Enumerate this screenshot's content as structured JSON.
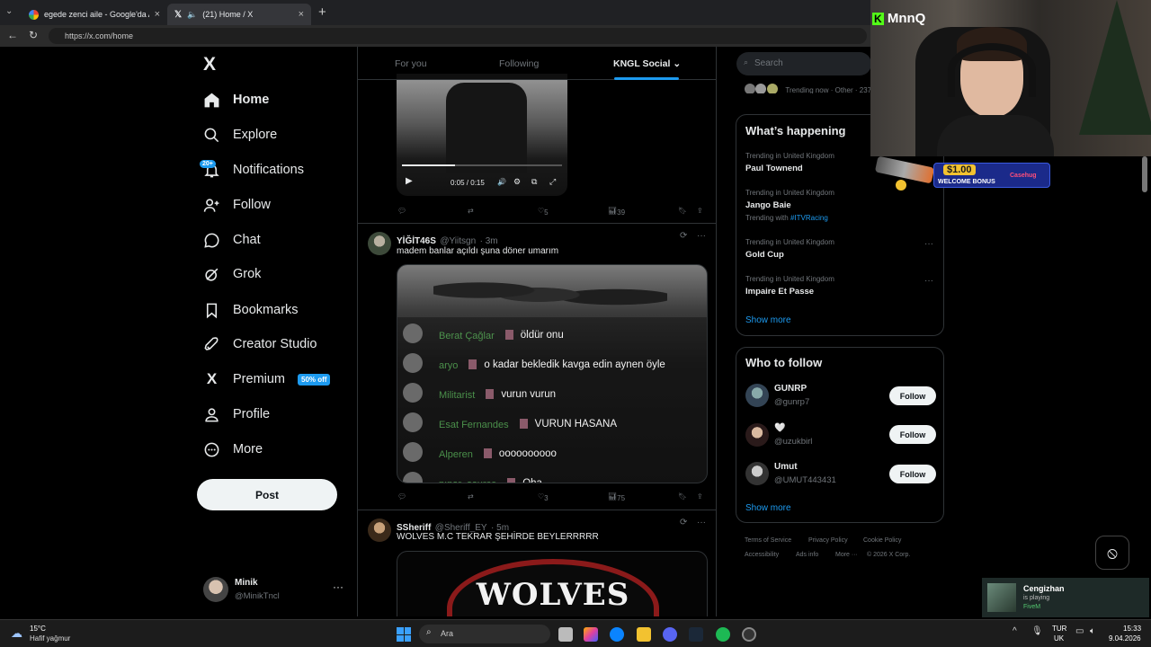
{
  "browser": {
    "tabs": [
      {
        "title": "egede zenci aile - Google'da Ara",
        "active": false
      },
      {
        "title": "(21) Home / X",
        "active": true
      }
    ],
    "url": "https://x.com/home",
    "new_tab_symbol": "+"
  },
  "sidebar": {
    "logo": "X",
    "items": [
      {
        "label": "Home",
        "icon": "home-icon",
        "active": true
      },
      {
        "label": "Explore",
        "icon": "search-icon"
      },
      {
        "label": "Notifications",
        "icon": "bell-icon",
        "badge": "20+"
      },
      {
        "label": "Follow",
        "icon": "person-add-icon"
      },
      {
        "label": "Chat",
        "icon": "chat-icon"
      },
      {
        "label": "Grok",
        "icon": "grok-icon"
      },
      {
        "label": "Bookmarks",
        "icon": "bookmark-icon"
      },
      {
        "label": "Creator Studio",
        "icon": "rocket-icon"
      },
      {
        "label": "Premium",
        "icon": "x-icon",
        "badge": "50% off"
      },
      {
        "label": "Profile",
        "icon": "person-icon"
      },
      {
        "label": "More",
        "icon": "more-circle-icon"
      }
    ],
    "post_label": "Post",
    "account": {
      "name": "Minik",
      "handle": "@MinikTncl"
    }
  },
  "feed": {
    "tabs": [
      "For you",
      "Following",
      "KNGL Social"
    ],
    "active_tab": "KNGL Social",
    "tweets": [
      {
        "video_time": "0:05 / 0:15",
        "progress": 0.33,
        "replies": "",
        "retweets": "",
        "likes": "5",
        "views": "39"
      },
      {
        "name": "YİĞİT46S",
        "handle": "@Yiitsgn",
        "time": "· 3m",
        "text": "madem banlar açıldı şuna döner umarım",
        "chat_overlay": [
          {
            "user": "Berat Çağlar",
            "msg": "öldür onu"
          },
          {
            "user": "aryo",
            "msg": "o kadar bekledik kavga edin aynen öyle"
          },
          {
            "user": "Militarist",
            "msg": "vurun vurun"
          },
          {
            "user": "Esat Fernandes",
            "msg": "VURUN HASANA"
          },
          {
            "user": "Alperen",
            "msg": "oooooooooo"
          },
          {
            "user": "pınar_source",
            "msg": "Oha"
          }
        ],
        "likes": "3",
        "views": "75"
      },
      {
        "name": "SSheriff",
        "handle": "@Sheriff_EY",
        "time": "· 5m",
        "text": "WOLVES M.C TEKRAR ŞEHİRDE BEYLERRRRR",
        "image_text": "WOLVES"
      }
    ]
  },
  "right": {
    "search_placeholder": "Search",
    "trending_now": "Trending now · Other · 237",
    "whats_happening": {
      "title": "What’s happening",
      "items": [
        {
          "meta": "Trending in United Kingdom",
          "name": "Paul Townend",
          "with": ""
        },
        {
          "meta": "Trending in United Kingdom",
          "name": "Jango Baie",
          "with_prefix": "Trending with",
          "with": "#ITVRacing"
        },
        {
          "meta": "Trending in United Kingdom",
          "name": "Gold Cup",
          "with": ""
        },
        {
          "meta": "Trending in United Kingdom",
          "name": "Impaire Et Passe",
          "with": ""
        }
      ],
      "show_more": "Show more"
    },
    "who_to_follow": {
      "title": "Who to follow",
      "users": [
        {
          "name": "GUNRP",
          "handle": "@gunrp7"
        },
        {
          "name": "🤍",
          "handle": "@uzukbirl"
        },
        {
          "name": "Umut",
          "handle": "@UMUT443431"
        }
      ],
      "follow_label": "Follow",
      "show_more": "Show more"
    },
    "footer": [
      "Terms of Service",
      "Privacy Policy",
      "Cookie Policy",
      "Accessibility",
      "Ads info",
      "More ···",
      "© 2026 X Corp."
    ]
  },
  "overlay": {
    "streamer": "MnnQ",
    "promo_amount": "$1.00",
    "promo_text": "WELCOME BONUS",
    "promo_brand": "Casehug",
    "activity": {
      "name": "Cengizhan",
      "status": "is playing",
      "game": "FiveM"
    }
  },
  "taskbar": {
    "weather_temp": "15°C",
    "weather_desc": "Hafif yağmur",
    "search_label": "Ara",
    "lang1": "TUR",
    "lang2": "UK",
    "time": "15:33",
    "date": "9.04.2026"
  },
  "colors": {
    "accent": "#1d9bf0",
    "bg": "#000000",
    "border": "#2f3336",
    "chat_user": "#5cb85c"
  }
}
